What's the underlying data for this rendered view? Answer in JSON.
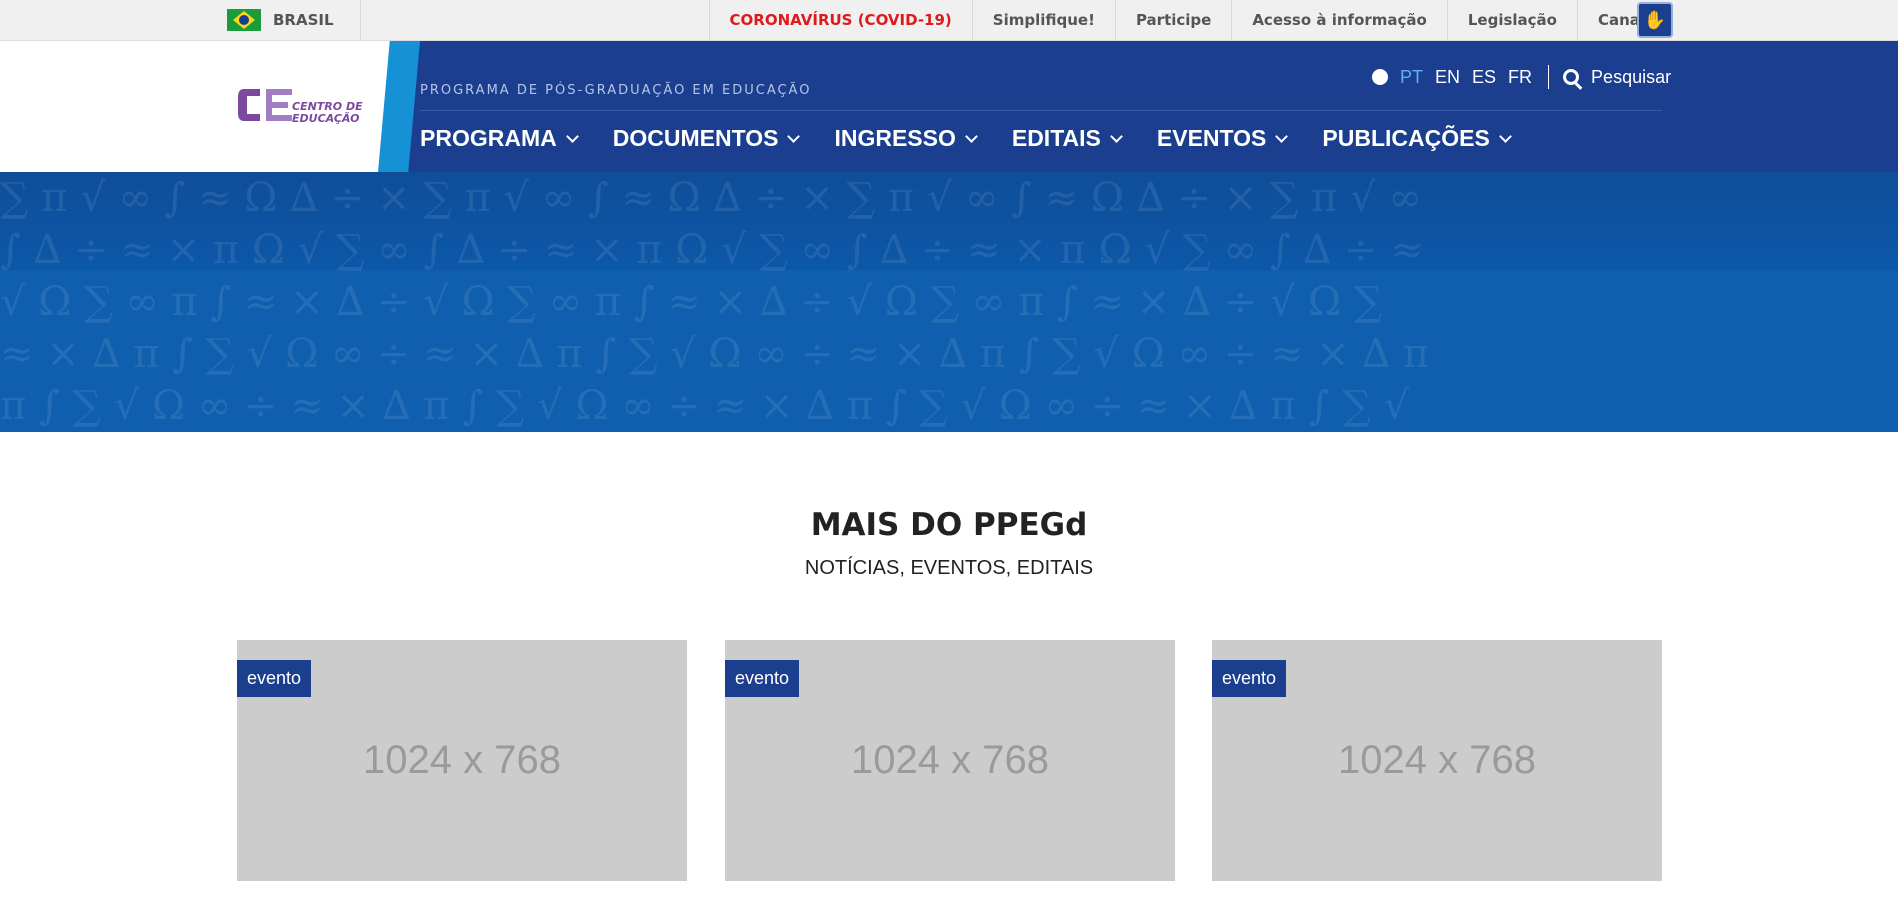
{
  "govbar": {
    "brasil": "BRASIL",
    "links": [
      "CORONAVÍRUS (COVID-19)",
      "Simplifique!",
      "Participe",
      "Acesso à informação",
      "Legislação",
      "Canais"
    ]
  },
  "header": {
    "logo_text_1": "CENTRO DE",
    "logo_text_2": "EDUCAÇÃO",
    "program_title": "PROGRAMA DE PÓS-GRADUAÇÃO EM EDUCAÇÃO",
    "languages": [
      "PT",
      "EN",
      "ES",
      "FR"
    ],
    "active_language": "PT",
    "search_label": "Pesquisar",
    "nav": [
      "PROGRAMA",
      "DOCUMENTOS",
      "INGRESSO",
      "EDITAIS",
      "EVENTOS",
      "PUBLICAÇÕES"
    ]
  },
  "section": {
    "title": "MAIS DO PPEGd",
    "subtitle": "NOTÍCIAS, EVENTOS, EDITAIS"
  },
  "cards": [
    {
      "tag": "evento",
      "placeholder": "1024 x 768"
    },
    {
      "tag": "evento",
      "placeholder": "1024 x 768"
    },
    {
      "tag": "evento",
      "placeholder": "1024 x 768"
    }
  ],
  "colors": {
    "navy": "#1b3f8e",
    "accent_blue": "#1691d5",
    "covid_red": "#e0191b",
    "logo_purple": "#7b4aa0"
  }
}
